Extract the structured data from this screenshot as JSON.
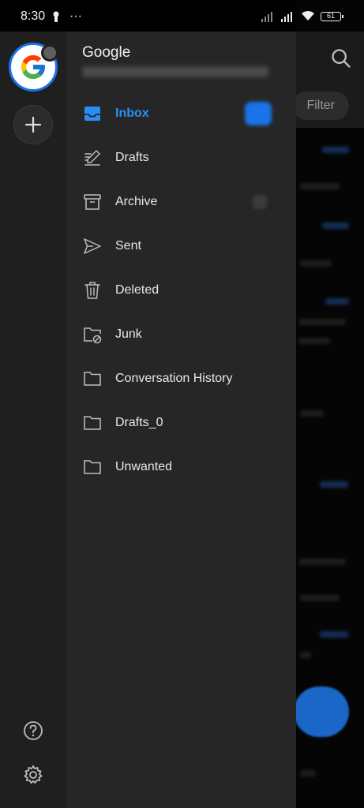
{
  "status_bar": {
    "time": "8:30",
    "more": "···",
    "battery": "61"
  },
  "account": {
    "name": "Google",
    "avatar_letter": "G"
  },
  "folders": [
    {
      "label": "Inbox",
      "icon": "inbox-icon",
      "active": true
    },
    {
      "label": "Drafts",
      "icon": "drafts-icon"
    },
    {
      "label": "Archive",
      "icon": "archive-icon"
    },
    {
      "label": "Sent",
      "icon": "sent-icon"
    },
    {
      "label": "Deleted",
      "icon": "trash-icon"
    },
    {
      "label": "Junk",
      "icon": "junk-icon"
    },
    {
      "label": "Conversation History",
      "icon": "folder-icon"
    },
    {
      "label": "Drafts_0",
      "icon": "folder-icon"
    },
    {
      "label": "Unwanted",
      "icon": "folder-icon"
    }
  ],
  "background": {
    "filter_label": "Filter"
  },
  "colors": {
    "accent": "#1a73e8",
    "active_text": "#2b8ef2",
    "drawer": "#262626",
    "rail": "#1f1f1f"
  }
}
